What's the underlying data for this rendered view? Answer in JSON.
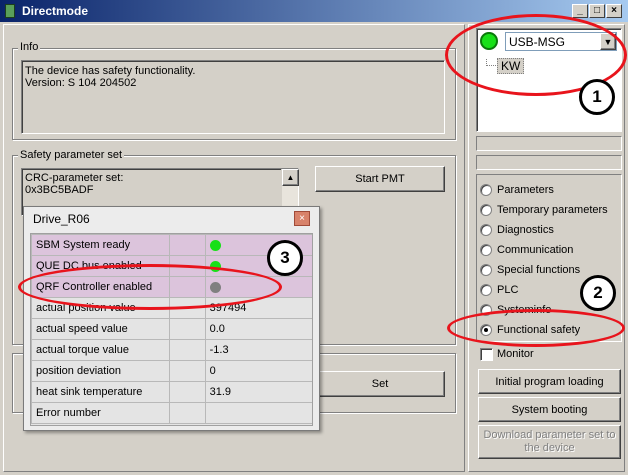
{
  "window": {
    "title": "Directmode"
  },
  "info": {
    "label": "Info",
    "line1": "The device has safety functionality.",
    "line2": "Version: S 104 204502"
  },
  "safety": {
    "label": "Safety parameter set",
    "crc_label": "CRC-parameter set:",
    "crc_value": "0x3BC5BADF",
    "start_pmt": "Start PMT",
    "set": "Set"
  },
  "connection": {
    "selected": "USB-MSG",
    "tree_item": "KW"
  },
  "radios": [
    {
      "label": "Parameters",
      "checked": false
    },
    {
      "label": "Temporary parameters",
      "checked": false
    },
    {
      "label": "Diagnostics",
      "checked": false
    },
    {
      "label": "Communication",
      "checked": false
    },
    {
      "label": "Special functions",
      "checked": false
    },
    {
      "label": "PLC",
      "checked": false
    },
    {
      "label": "Systeminfo",
      "checked": false
    },
    {
      "label": "Functional safety",
      "checked": true
    }
  ],
  "monitor": {
    "label": "Monitor",
    "checked": false
  },
  "buttons": {
    "initial_program_loading": "Initial program loading",
    "system_booting": "System booting",
    "download_line1": "Download parameter set to",
    "download_line2": "the device"
  },
  "annotations": [
    "1",
    "2",
    "3"
  ],
  "drive": {
    "title": "Drive_R06",
    "rows": [
      {
        "label": "SBM System ready",
        "value": "",
        "led": "#18e018",
        "highlight": true
      },
      {
        "label": "QUE DC bus enabled",
        "value": "",
        "led": "#18e018",
        "highlight": true
      },
      {
        "label": "QRF Controller enabled",
        "value": "",
        "led": "#808080",
        "highlight": true
      },
      {
        "label": "actual position value",
        "value": "397494",
        "led": "",
        "highlight": false
      },
      {
        "label": "actual speed value",
        "value": "0.0",
        "led": "",
        "highlight": false
      },
      {
        "label": "actual torque value",
        "value": "-1.3",
        "led": "",
        "highlight": false
      },
      {
        "label": "position deviation",
        "value": "0",
        "led": "",
        "highlight": false
      },
      {
        "label": "heat sink temperature",
        "value": "31.9",
        "led": "",
        "highlight": false
      },
      {
        "label": "Error number",
        "value": "",
        "led": "",
        "highlight": false
      }
    ]
  },
  "colors": {
    "annotation_red": "#e8141c",
    "status_green": "#18e018",
    "highlight_rows": "#dcc4dc"
  }
}
